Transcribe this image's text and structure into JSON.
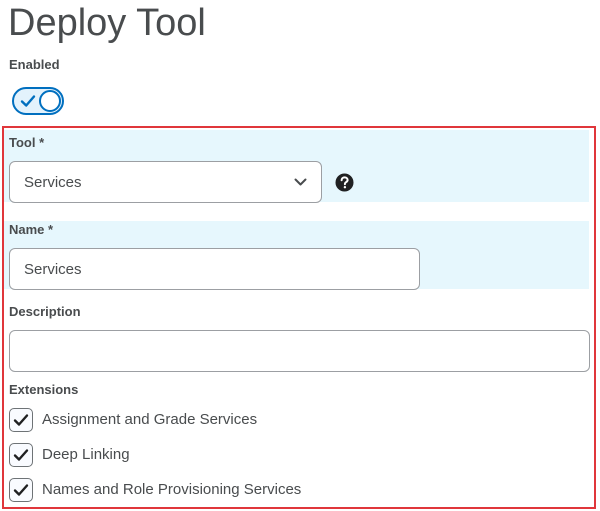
{
  "page": {
    "title": "Deploy Tool"
  },
  "enabled": {
    "label": "Enabled",
    "checked": true
  },
  "tool": {
    "label": "Tool *",
    "selected": "Services",
    "help_icon": "question-circle-icon"
  },
  "name": {
    "label": "Name *",
    "value": "Services"
  },
  "description": {
    "label": "Description",
    "value": ""
  },
  "extensions": {
    "label": "Extensions",
    "items": [
      {
        "label": "Assignment and Grade Services",
        "checked": true
      },
      {
        "label": "Deep Linking",
        "checked": true
      },
      {
        "label": "Names and Role Provisioning Services",
        "checked": true
      }
    ]
  },
  "colors": {
    "accent": "#006fbf",
    "highlight_band": "#e6f7fd",
    "annotation_frame": "#e0363b",
    "text": "#494c4e"
  }
}
